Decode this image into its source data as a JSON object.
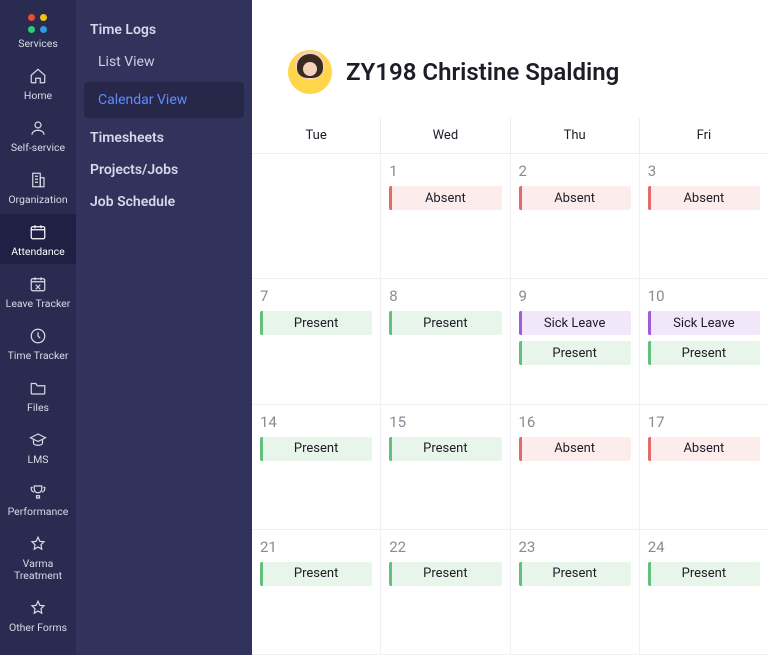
{
  "rail": {
    "items": [
      {
        "label": "Services",
        "icon": "brand-dots-icon"
      },
      {
        "label": "Home",
        "icon": "home-icon"
      },
      {
        "label": "Self-service",
        "icon": "person-icon"
      },
      {
        "label": "Organization",
        "icon": "building-icon"
      },
      {
        "label": "Attendance",
        "icon": "calendar-check-icon",
        "active": true
      },
      {
        "label": "Leave Tracker",
        "icon": "calendar-x-icon"
      },
      {
        "label": "Time Tracker",
        "icon": "clock-icon"
      },
      {
        "label": "Files",
        "icon": "folder-icon"
      },
      {
        "label": "LMS",
        "icon": "graduation-icon"
      },
      {
        "label": "Performance",
        "icon": "trophy-icon"
      },
      {
        "label": "Varma Treatment",
        "icon": "star-icon"
      },
      {
        "label": "Other Forms",
        "icon": "star-icon"
      }
    ]
  },
  "subnav": {
    "groups": [
      {
        "title": "Time Logs",
        "items": [
          {
            "label": "List View"
          },
          {
            "label": "Calendar View",
            "active": true
          }
        ]
      },
      {
        "title": "Timesheets",
        "items": []
      },
      {
        "title": "Projects/Jobs",
        "items": []
      },
      {
        "title": "Job Schedule",
        "items": []
      }
    ]
  },
  "user": {
    "display": "ZY198 Christine Spalding"
  },
  "calendar": {
    "days_of_week": [
      "Tue",
      "Wed",
      "Thu",
      "Fri"
    ],
    "status_labels": {
      "present": "Present",
      "absent": "Absent",
      "sick": "Sick Leave"
    },
    "status_colors": {
      "present": "#63c07b",
      "absent": "#e46a6a",
      "sick": "#a05bd9"
    },
    "rows": [
      [
        {
          "date": "",
          "statuses": []
        },
        {
          "date": "1",
          "statuses": [
            "absent"
          ]
        },
        {
          "date": "2",
          "statuses": [
            "absent"
          ]
        },
        {
          "date": "3",
          "statuses": [
            "absent"
          ]
        }
      ],
      [
        {
          "date": "7",
          "statuses": [
            "present"
          ]
        },
        {
          "date": "8",
          "statuses": [
            "present"
          ]
        },
        {
          "date": "9",
          "statuses": [
            "sick",
            "present"
          ]
        },
        {
          "date": "10",
          "statuses": [
            "sick",
            "present"
          ]
        }
      ],
      [
        {
          "date": "14",
          "statuses": [
            "present"
          ]
        },
        {
          "date": "15",
          "statuses": [
            "present"
          ]
        },
        {
          "date": "16",
          "statuses": [
            "absent"
          ]
        },
        {
          "date": "17",
          "statuses": [
            "absent"
          ]
        }
      ],
      [
        {
          "date": "21",
          "statuses": [
            "present"
          ]
        },
        {
          "date": "22",
          "statuses": [
            "present"
          ]
        },
        {
          "date": "23",
          "statuses": [
            "present"
          ]
        },
        {
          "date": "24",
          "statuses": [
            "present"
          ]
        }
      ]
    ]
  }
}
